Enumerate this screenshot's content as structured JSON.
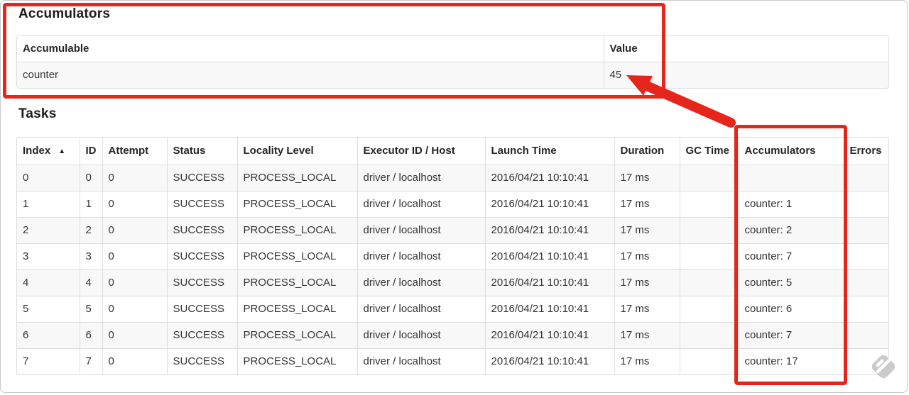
{
  "accumulators_section": {
    "heading": "Accumulators",
    "columns": [
      "Accumulable",
      "Value"
    ],
    "rows": [
      [
        "counter",
        "45"
      ]
    ]
  },
  "tasks_section": {
    "heading": "Tasks",
    "columns": [
      "Index",
      "ID",
      "Attempt",
      "Status",
      "Locality Level",
      "Executor ID / Host",
      "Launch Time",
      "Duration",
      "GC Time",
      "Accumulators",
      "Errors"
    ],
    "sort": {
      "column": "Index",
      "direction_icon": "▲"
    },
    "rows": [
      [
        "0",
        "0",
        "0",
        "SUCCESS",
        "PROCESS_LOCAL",
        "driver / localhost",
        "2016/04/21 10:10:41",
        "17 ms",
        "",
        "",
        ""
      ],
      [
        "1",
        "1",
        "0",
        "SUCCESS",
        "PROCESS_LOCAL",
        "driver / localhost",
        "2016/04/21 10:10:41",
        "17 ms",
        "",
        "counter: 1",
        ""
      ],
      [
        "2",
        "2",
        "0",
        "SUCCESS",
        "PROCESS_LOCAL",
        "driver / localhost",
        "2016/04/21 10:10:41",
        "17 ms",
        "",
        "counter: 2",
        ""
      ],
      [
        "3",
        "3",
        "0",
        "SUCCESS",
        "PROCESS_LOCAL",
        "driver / localhost",
        "2016/04/21 10:10:41",
        "17 ms",
        "",
        "counter: 7",
        ""
      ],
      [
        "4",
        "4",
        "0",
        "SUCCESS",
        "PROCESS_LOCAL",
        "driver / localhost",
        "2016/04/21 10:10:41",
        "17 ms",
        "",
        "counter: 5",
        ""
      ],
      [
        "5",
        "5",
        "0",
        "SUCCESS",
        "PROCESS_LOCAL",
        "driver / localhost",
        "2016/04/21 10:10:41",
        "17 ms",
        "",
        "counter: 6",
        ""
      ],
      [
        "6",
        "6",
        "0",
        "SUCCESS",
        "PROCESS_LOCAL",
        "driver / localhost",
        "2016/04/21 10:10:41",
        "17 ms",
        "",
        "counter: 7",
        ""
      ],
      [
        "7",
        "7",
        "0",
        "SUCCESS",
        "PROCESS_LOCAL",
        "driver / localhost",
        "2016/04/21 10:10:41",
        "17 ms",
        "",
        "counter: 17",
        ""
      ]
    ]
  },
  "annotations": {
    "color": "#e6251c",
    "watermark_color": "#c7c7c7"
  }
}
